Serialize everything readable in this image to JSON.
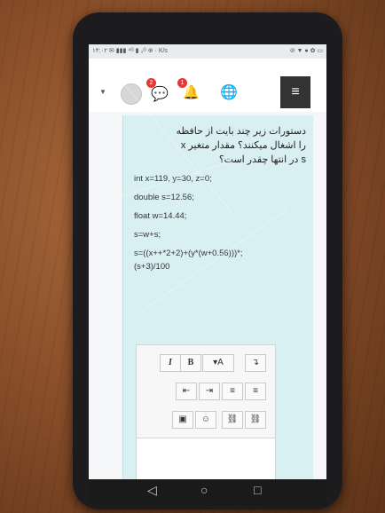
{
  "status_bar": {
    "left": "۱۴:۰۲ ✉ ▮▮▮ ⁴ᴳ ▮ ₃ᴳ ⊕ · K/s",
    "right": "⊘ ▼ ● ✿ ▭"
  },
  "header": {
    "notifications": {
      "messages_count": "2",
      "alerts_count": "1"
    },
    "icons": [
      "avatar",
      "chat-icon",
      "bell-icon",
      "globe-icon",
      "menu-icon"
    ]
  },
  "question": {
    "text_line1": "دستورات زیر چند بایت از حافظه",
    "text_line2": "را اشغال میکنند؟ مقدار متغیر x",
    "text_line3": "s  در انتها چقدر است؟",
    "code": [
      "int x=119, y=30, z=0;",
      "double  s=12.56;",
      "float   w=14.44;",
      "s=w+s;",
      "s=((x++*2+2)+(y*(w+0.56)))*;",
      "(s+3)/100"
    ]
  },
  "editor": {
    "toolbar_row1": [
      "I",
      "B",
      "▾A",
      "↴"
    ],
    "toolbar_row2": [
      "⇤",
      "⇥",
      "≡",
      "≡"
    ],
    "toolbar_row3": [
      "▣",
      "☺",
      "⛓",
      "⛓"
    ]
  },
  "nav": {
    "back": "◁",
    "home": "○",
    "recents": "□"
  }
}
